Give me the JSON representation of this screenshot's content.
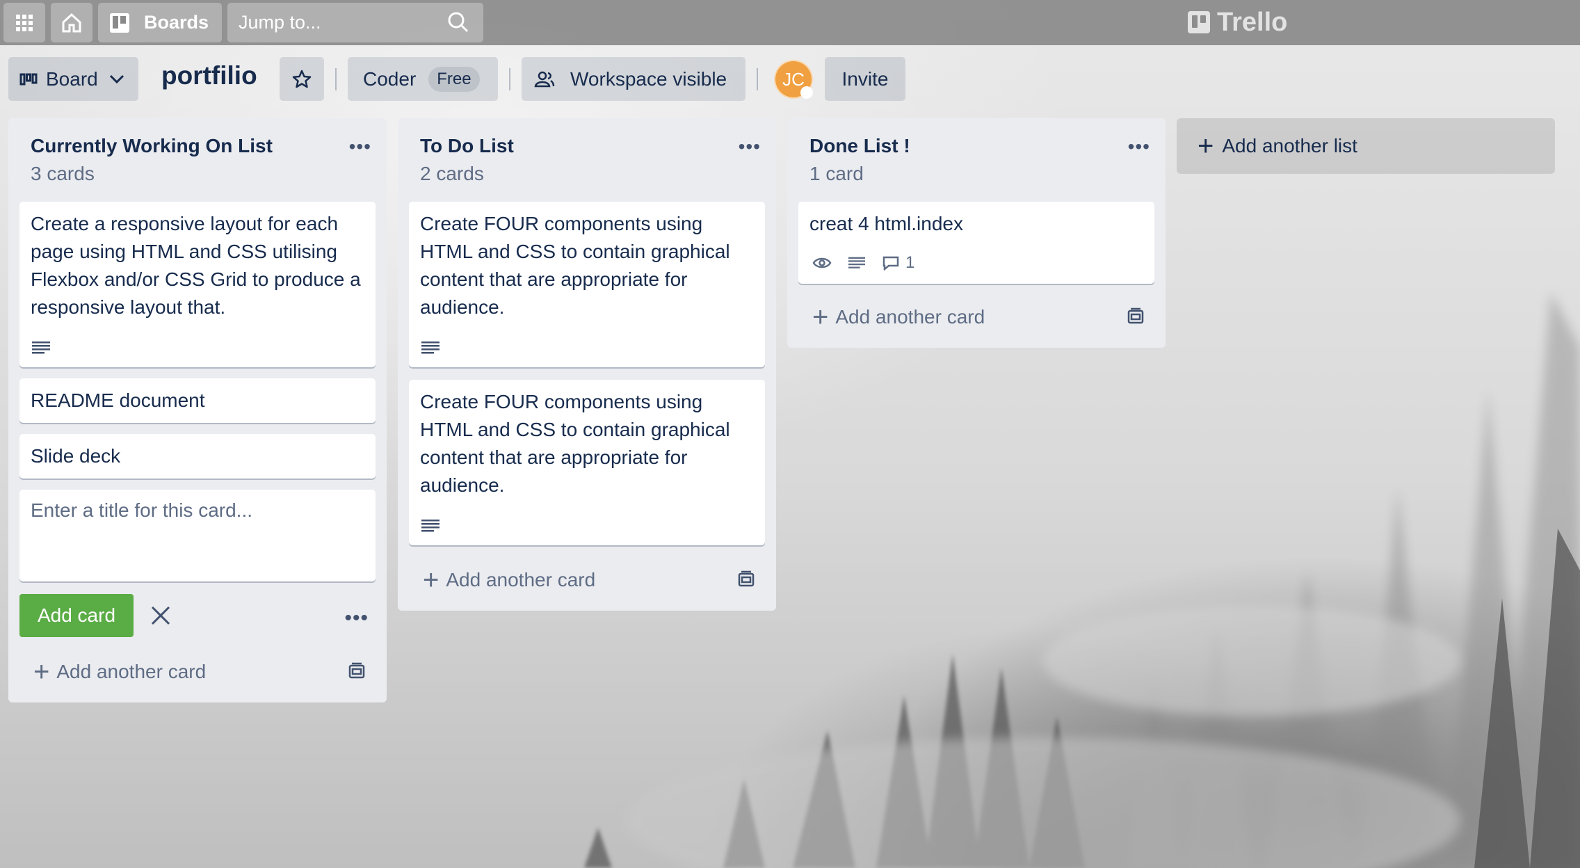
{
  "header": {
    "boards_label": "Boards",
    "search_placeholder": "Jump to...",
    "brand": "Trello"
  },
  "board": {
    "view_label": "Board",
    "title": "portfilio",
    "workspace": "Coder",
    "plan_badge": "Free",
    "visibility": "Workspace visible",
    "avatar_initials": "JC",
    "invite_label": "Invite"
  },
  "lists": [
    {
      "title": "Currently Working On List",
      "count": "3 cards",
      "cards": [
        "Create a responsive layout for each page using HTML and CSS utilising Flexbox and/or CSS Grid to produce a responsive layout that.",
        "README document",
        "Slide deck"
      ],
      "composer_placeholder": "Enter a title for this card...",
      "add_card_label": "Add card",
      "add_another_label": "Add another card"
    },
    {
      "title": "To Do List",
      "count": "2 cards",
      "cards": [
        "Create FOUR components using HTML and CSS to contain graphical content that are appropriate for audience.",
        "Create FOUR components using HTML and CSS to contain graphical content that are appropriate for audience."
      ],
      "add_another_label": "Add another card"
    },
    {
      "title": "Done List !",
      "count": "1 card",
      "cards": [
        "creat 4 html.index"
      ],
      "comment_count": "1",
      "add_another_label": "Add another card"
    }
  ],
  "add_list_label": "Add another list",
  "icons": [
    "apps-grid-icon",
    "home-icon",
    "boards-icon",
    "search-icon",
    "board-view-icon",
    "chevron-down-icon",
    "star-icon",
    "workspace-visible-icon",
    "more-icon",
    "description-icon",
    "watch-icon",
    "comment-icon",
    "plus-icon",
    "close-icon",
    "card-template-icon"
  ]
}
